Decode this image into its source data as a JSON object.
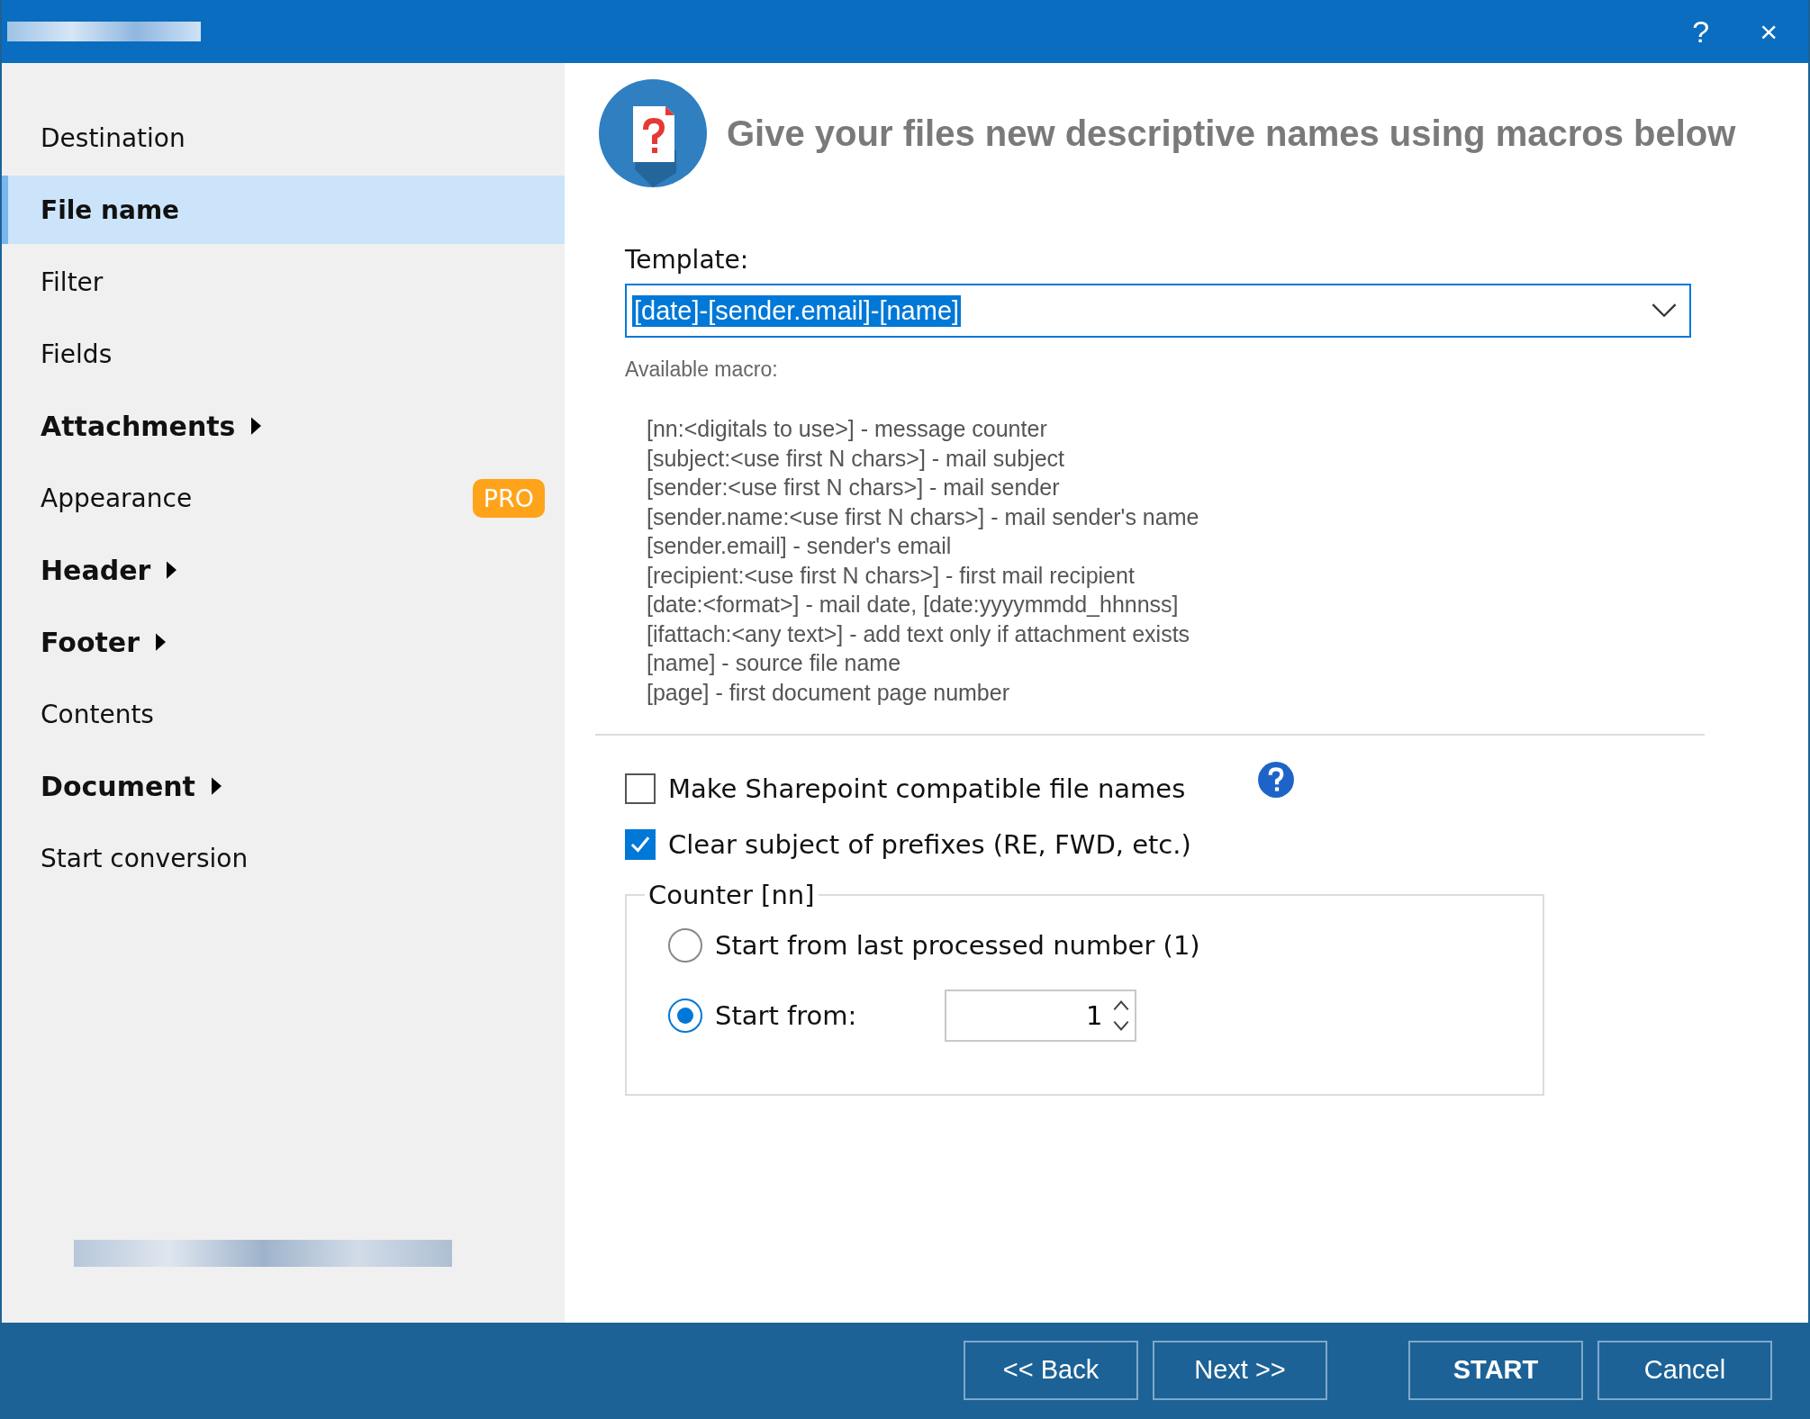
{
  "window": {
    "help_glyph": "?",
    "close_glyph": "×"
  },
  "sidebar": {
    "items": [
      {
        "label": "Destination",
        "kind": "page",
        "selected": false
      },
      {
        "label": "File name",
        "kind": "page",
        "selected": true
      },
      {
        "label": "Filter",
        "kind": "page",
        "selected": false
      },
      {
        "label": "Fields",
        "kind": "page",
        "selected": false
      },
      {
        "label": "Attachments",
        "kind": "group",
        "selected": false
      },
      {
        "label": "Appearance",
        "kind": "page",
        "selected": false,
        "badge": "PRO"
      },
      {
        "label": "Header",
        "kind": "group",
        "selected": false
      },
      {
        "label": "Footer",
        "kind": "group",
        "selected": false
      },
      {
        "label": "Contents",
        "kind": "page",
        "selected": false
      },
      {
        "label": "Document",
        "kind": "group",
        "selected": false
      },
      {
        "label": "Start conversion",
        "kind": "page",
        "selected": false
      }
    ]
  },
  "header": {
    "title": "Give your files new descriptive names using macros below"
  },
  "template": {
    "label": "Template:",
    "value": "[date]-[sender.email]-[name]",
    "text_selected": true
  },
  "macros": {
    "label": "Available macro:",
    "lines": [
      "[nn:<digitals to use>] - message counter",
      "[subject:<use first N chars>] - mail subject",
      "[sender:<use first N chars>] - mail sender",
      "[sender.name:<use first N chars>] - mail sender's name",
      "[sender.email] - sender's email",
      "[recipient:<use first N chars>] - first mail recipient",
      "[date:<format>] - mail date, [date:yyyymmdd_hhnnss]",
      "[ifattach:<any text>] - add text only if attachment exists",
      "[name] - source file name",
      "[page] - first document page number"
    ]
  },
  "options": [
    {
      "label": "Make Sharepoint compatible file names",
      "checked": false,
      "help": true
    },
    {
      "label": "Clear subject of prefixes (RE, FWD, etc.)",
      "checked": true,
      "help": false
    }
  ],
  "counter": {
    "title": "Counter [nn]",
    "options": [
      {
        "label": "Start from last processed number (1)",
        "selected": false
      },
      {
        "label": "Start from:",
        "selected": true,
        "value": "1"
      }
    ]
  },
  "buttons": [
    {
      "label": "<< Back",
      "kind": "nav"
    },
    {
      "label": "Next >>",
      "kind": "nav"
    },
    {
      "label": "START",
      "kind": "primary"
    },
    {
      "label": "Cancel",
      "kind": "nav"
    }
  ]
}
